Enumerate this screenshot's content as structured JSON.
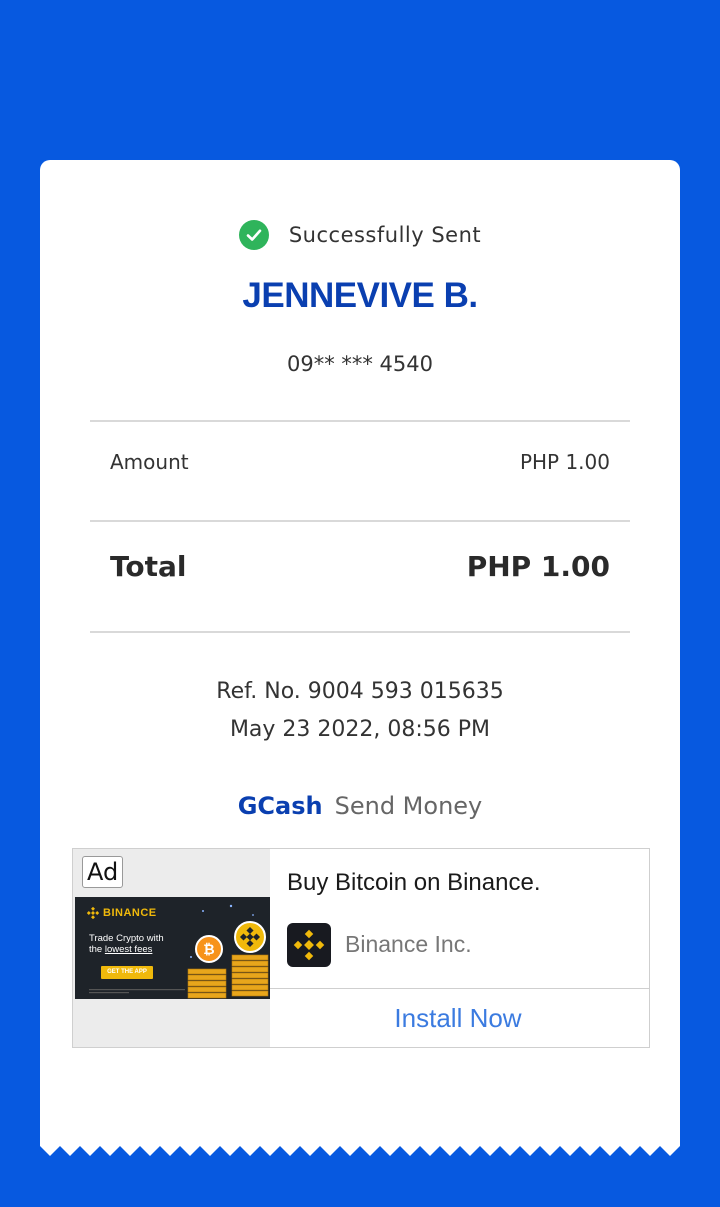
{
  "colors": {
    "background": "#0759E0",
    "card": "#FFFFFF",
    "success": "#2FB45B",
    "name": "#0A3FB0",
    "cta": "#3B7BE0",
    "binance": "#F0B90B"
  },
  "receipt": {
    "status": "Successfully Sent",
    "status_icon": "check-icon",
    "recipient_name": "JENNEVIVE B.",
    "recipient_number": "09** *** 4540",
    "amount_label": "Amount",
    "amount_value": "PHP 1.00",
    "total_label": "Total",
    "total_value": "PHP 1.00",
    "ref_no": "Ref. No. 9004 593 015635",
    "datetime": "May 23 2022, 08:56 PM",
    "brand": "GCash",
    "service": "Send Money"
  },
  "ad": {
    "badge": "Ad",
    "banner_brand": "BINANCE",
    "banner_tagline_1": "Trade Crypto with",
    "banner_tagline_2": "the",
    "banner_tagline_3": "lowest fees",
    "banner_cta": "GET THE APP",
    "title": "Buy Bitcoin on Binance.",
    "advertiser": "Binance Inc.",
    "cta": "Install Now"
  }
}
